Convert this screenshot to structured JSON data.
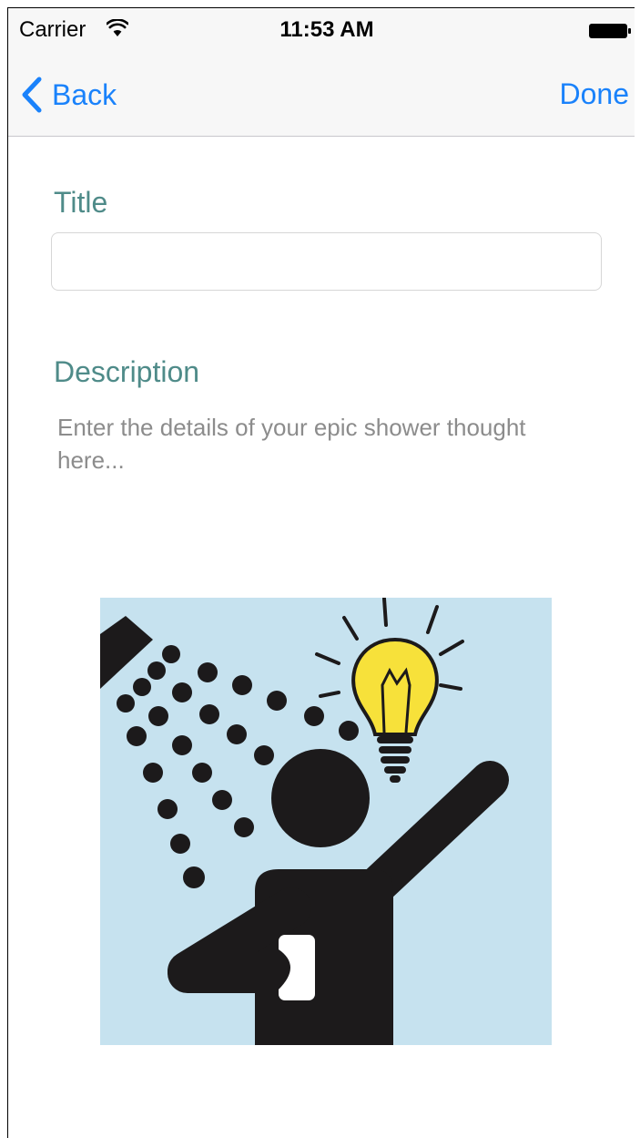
{
  "status_bar": {
    "carrier": "Carrier",
    "time": "11:53 AM",
    "wifi_icon": "wifi-icon",
    "battery_icon": "battery-icon"
  },
  "nav_bar": {
    "back_label": "Back",
    "back_icon": "chevron-left-icon",
    "done_label": "Done"
  },
  "form": {
    "title_label": "Title",
    "title_value": "",
    "description_label": "Description",
    "description_placeholder": "Enter the details of your epic shower thought here..."
  },
  "illustration": {
    "icon": "shower-thought-lightbulb-icon"
  },
  "colors": {
    "accent": "#1a82fb",
    "label": "#4f8b89",
    "placeholder": "#8c8c8c",
    "illustration_bg": "#c6e2ef",
    "bulb": "#f7e13a"
  }
}
